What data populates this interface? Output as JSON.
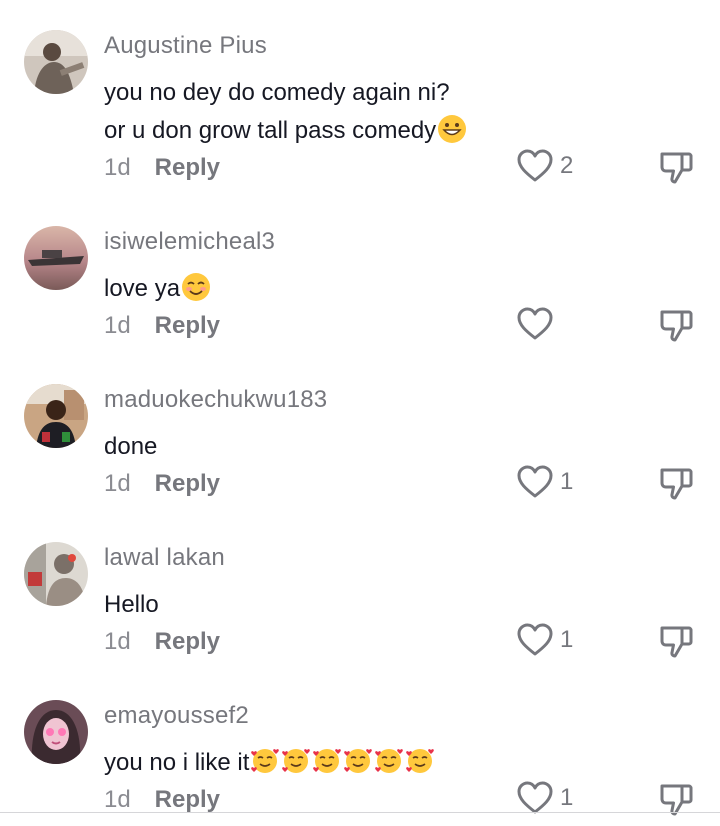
{
  "reply_label": "Reply",
  "comments": [
    {
      "username": "Augustine Pius",
      "lines": [
        "you no dey do comedy again ni?",
        "or u don grow tall pass comedy"
      ],
      "emoji": "grinning-face",
      "time": "1d",
      "likes": "2"
    },
    {
      "username": "isiwelemicheal3",
      "lines": [
        "love ya"
      ],
      "emoji": "smiling-face",
      "time": "1d",
      "likes": ""
    },
    {
      "username": "maduokechukwu183",
      "lines": [
        "done"
      ],
      "time": "1d",
      "likes": "1"
    },
    {
      "username": "lawal lakan",
      "lines": [
        "Hello"
      ],
      "time": "1d",
      "likes": "1"
    },
    {
      "username": "emayoussef2",
      "lines": [
        "you no i like it"
      ],
      "emoji": "smiling-face-with-hearts",
      "emoji_count": 6,
      "time": "1d",
      "likes": "1"
    }
  ]
}
